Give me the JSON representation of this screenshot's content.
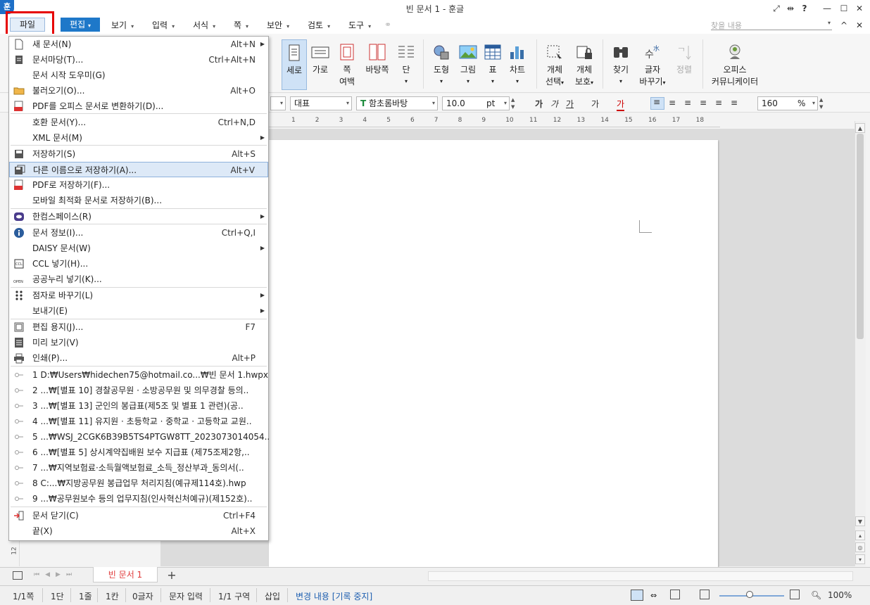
{
  "window": {
    "title": "빈 문서 1 - 훈글",
    "app_icon": "훈"
  },
  "menubar": {
    "file": "파일",
    "edit": "편집",
    "items": [
      "보기",
      "입력",
      "서식",
      "쪽",
      "보안",
      "검토",
      "도구"
    ],
    "search_placeholder": "찾을 내용"
  },
  "ribbon": {
    "vertical": "세로",
    "horizontal": "가로",
    "page_margin_1": "쪽",
    "page_margin_2": "여백",
    "background_page": "바탕쪽",
    "column": "단",
    "shape": "도형",
    "picture": "그림",
    "table": "표",
    "chart": "차트",
    "select_obj_1": "개체",
    "select_obj_2": "선택",
    "protect_obj_1": "개체",
    "protect_obj_2": "보호",
    "find": "찾기",
    "replace_1": "글자",
    "replace_2": "바꾸기",
    "sort": "정렬",
    "communicator_1": "오피스",
    "communicator_2": "커뮤니케이터"
  },
  "format": {
    "style": "대표",
    "font": "함초롬바탕",
    "size": "10.0",
    "unit": "pt",
    "zoom": "160",
    "zoom_unit": "%",
    "b1": "가",
    "b2": "가",
    "b3": "가",
    "b4": "가",
    "b5": "가"
  },
  "ruler": {
    "numbers": [
      "1",
      "2",
      "3",
      "4",
      "5",
      "6",
      "7",
      "8",
      "9",
      "10",
      "11",
      "12",
      "13",
      "14",
      "15",
      "16",
      "17",
      "18"
    ]
  },
  "file_menu": {
    "items": [
      {
        "label": "새 문서(N)",
        "shortcut": "Alt+N",
        "sub": "▶"
      },
      {
        "label": "문서마당(T)...",
        "shortcut": "Ctrl+Alt+N"
      },
      {
        "label": "문서 시작 도우미(G)"
      },
      {
        "label": "불러오기(O)...",
        "shortcut": "Alt+O"
      },
      {
        "label": "PDF를 오피스 문서로 변환하기(D)..."
      },
      {
        "label": "호환 문서(Y)...",
        "shortcut": "Ctrl+N,D"
      },
      {
        "label": "XML 문서(M)",
        "sub": "▶"
      },
      {
        "label": "저장하기(S)",
        "shortcut": "Alt+S"
      },
      {
        "label": "다른 이름으로 저장하기(A)...",
        "shortcut": "Alt+V"
      },
      {
        "label": "PDF로 저장하기(F)..."
      },
      {
        "label": "모바일 최적화 문서로 저장하기(B)..."
      },
      {
        "label": "한컴스페이스(R)",
        "sub": "▶"
      },
      {
        "label": "문서 정보(I)...",
        "shortcut": "Ctrl+Q,I"
      },
      {
        "label": "DAISY 문서(W)",
        "sub": "▶"
      },
      {
        "label": "CCL 넣기(H)..."
      },
      {
        "label": "공공누리 넣기(K)..."
      },
      {
        "label": "점자로 바꾸기(L)",
        "sub": "▶"
      },
      {
        "label": "보내기(E)",
        "sub": "▶"
      },
      {
        "label": "편집 용지(J)...",
        "shortcut": "F7"
      },
      {
        "label": "미리 보기(V)"
      },
      {
        "label": "인쇄(P)...",
        "shortcut": "Alt+P"
      },
      {
        "label": "1 D:₩Users₩hidechen75@hotmail.co...₩빈 문서 1.hwpx"
      },
      {
        "label": "2 ...₩[별표 10] 경찰공무원 · 소방공무원 및 의무경찰 등의.."
      },
      {
        "label": "3 ...₩[별표 13] 군인의 봉급표(제5조 및 별표 1 관련)(공.."
      },
      {
        "label": "4 ...₩[별표 11] 유지원 · 초등학교 · 중학교 · 고등학교 교원.."
      },
      {
        "label": "5 ...₩WSJ_2CGK6B39B5TS4PTGW8TT_2023073014054.."
      },
      {
        "label": "6 ...₩[별표 5] 상시계약집배원 보수 지급표 (제75조제2항,.."
      },
      {
        "label": "7 ...₩지역보험료·소득월액보험료_소득_정산부과_동의서(.."
      },
      {
        "label": "8 C:...₩지방공무원 봉급업무 처리지침(예규제114호).hwp"
      },
      {
        "label": "9 ...₩공무원보수 등의 업무지침(인사혁신처예규)(제152호).."
      },
      {
        "label": "문서 닫기(C)",
        "shortcut": "Ctrl+F4"
      },
      {
        "label": "끝(X)",
        "shortcut": "Alt+X"
      }
    ]
  },
  "tabs": {
    "doc": "빈 문서 1",
    "add": "+"
  },
  "status": {
    "page": "1/1쪽",
    "col": "1단",
    "line": "1줄",
    "ch": "1칸",
    "chars": "0글자",
    "mode": "문자 입력",
    "section": "1/1 구역",
    "insert": "삽입",
    "track": "변경 내용 [기록 중지]",
    "zoom": "100%"
  },
  "colors": {
    "accent": "#1e78c9",
    "highlight_box": "#e60000",
    "menu_hover": "#dde9f7"
  }
}
